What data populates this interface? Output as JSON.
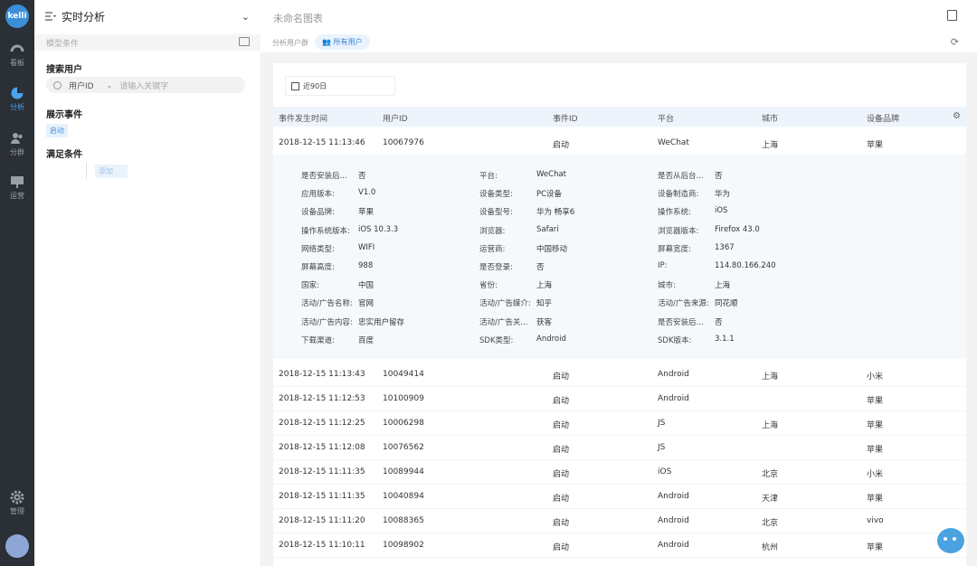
{
  "nav": {
    "logo": "kelli",
    "items": [
      {
        "label": "看板",
        "icon": "dashboard-icon"
      },
      {
        "label": "分析",
        "icon": "analysis-icon"
      },
      {
        "label": "分群",
        "icon": "user-group-icon"
      },
      {
        "label": "运营",
        "icon": "operation-icon"
      },
      {
        "label": "管理",
        "icon": "gear-icon"
      }
    ],
    "active": "分析"
  },
  "panel": {
    "title": "实时分析",
    "model_condition": "模型条件",
    "search_section": "搜索用户",
    "search_field": "用户ID",
    "search_placeholder": "请输入关键字",
    "show_events_section": "展示事件",
    "event_tag": "启动",
    "condition_section": "满足条件",
    "condition_tag": "添加"
  },
  "topbar": {
    "chart_name": "未命名图表",
    "group_label": "分析用户群",
    "group_tag": "所有用户"
  },
  "date_range": "近90日",
  "table": {
    "headers": [
      "事件发生时间",
      "用户ID",
      "事件ID",
      "平台",
      "城市",
      "设备品牌"
    ],
    "rows": [
      [
        "2018-12-15 11:13:46",
        "10067976",
        "启动",
        "WeChat",
        "上海",
        "苹果"
      ],
      [
        "2018-12-15 11:13:43",
        "10049414",
        "启动",
        "Android",
        "上海",
        "小米"
      ],
      [
        "2018-12-15 11:12:53",
        "10100909",
        "启动",
        "Android",
        "",
        "苹果"
      ],
      [
        "2018-12-15 11:12:25",
        "10006298",
        "启动",
        "JS",
        "上海",
        "苹果"
      ],
      [
        "2018-12-15 11:12:08",
        "10076562",
        "启动",
        "JS",
        "",
        "苹果"
      ],
      [
        "2018-12-15 11:11:35",
        "10089944",
        "启动",
        "iOS",
        "北京",
        "小米"
      ],
      [
        "2018-12-15 11:11:35",
        "10040894",
        "启动",
        "Android",
        "天津",
        "苹果"
      ],
      [
        "2018-12-15 11:11:20",
        "10088365",
        "启动",
        "Android",
        "北京",
        "vivo"
      ],
      [
        "2018-12-15 11:10:11",
        "10098902",
        "启动",
        "Android",
        "杭州",
        "苹果"
      ]
    ]
  },
  "detail": [
    [
      [
        "是否安装后...",
        "否"
      ],
      [
        "平台:",
        "WeChat"
      ],
      [
        "是否从后台...",
        "否"
      ]
    ],
    [
      [
        "应用版本:",
        "V1.0"
      ],
      [
        "设备类型:",
        "PC设备"
      ],
      [
        "设备制造商:",
        "华为"
      ]
    ],
    [
      [
        "设备品牌:",
        "苹果"
      ],
      [
        "设备型号:",
        "华为 畅享6"
      ],
      [
        "操作系统:",
        "iOS"
      ]
    ],
    [
      [
        "操作系统版本:",
        "iOS 10.3.3"
      ],
      [
        "浏览器:",
        "Safari"
      ],
      [
        "浏览器版本:",
        "Firefox 43.0"
      ]
    ],
    [
      [
        "网络类型:",
        "WIFI"
      ],
      [
        "运营商:",
        "中国移动"
      ],
      [
        "屏幕宽度:",
        "1367"
      ]
    ],
    [
      [
        "屏幕高度:",
        "988"
      ],
      [
        "是否登录:",
        "否"
      ],
      [
        "IP:",
        "114.80.166.240"
      ]
    ],
    [
      [
        "国家:",
        "中国"
      ],
      [
        "省份:",
        "上海"
      ],
      [
        "城市:",
        "上海"
      ]
    ],
    [
      [
        "活动/广告名称:",
        "官网"
      ],
      [
        "活动/广告媒介:",
        "知乎"
      ],
      [
        "活动/广告来源:",
        "同花顺"
      ]
    ],
    [
      [
        "活动/广告内容:",
        "忠实用户留存"
      ],
      [
        "活动/广告关...",
        "获客"
      ],
      [
        "是否安装后...",
        "否"
      ]
    ],
    [
      [
        "下载渠道:",
        "百度"
      ],
      [
        "SDK类型:",
        "Android"
      ],
      [
        "SDK版本:",
        "3.1.1"
      ]
    ]
  ]
}
